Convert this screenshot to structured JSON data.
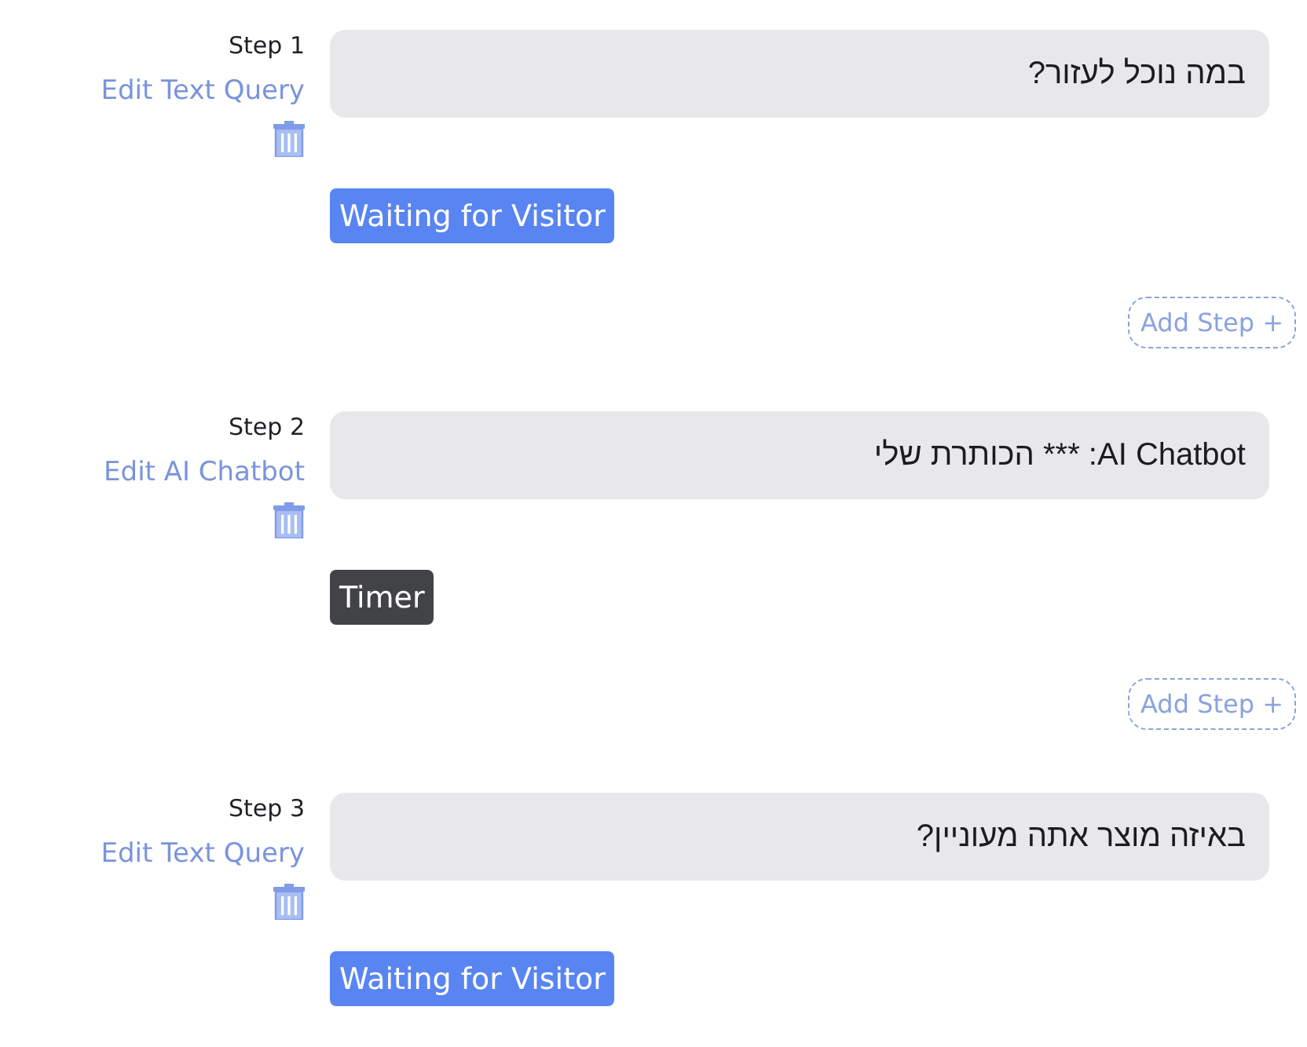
{
  "steps": [
    {
      "label": "Step 1",
      "edit_link": "Edit Text Query",
      "message": "במה נוכל לעזור?",
      "status": {
        "kind": "waiting",
        "label": "Waiting for Visitor"
      },
      "add_step": "Add Step +"
    },
    {
      "label": "Step 2",
      "edit_link": "Edit AI Chatbot",
      "message": "AI Chatbot: *** הכותרת שלי",
      "status": {
        "kind": "timer",
        "label": "Timer"
      },
      "add_step": "Add Step +"
    },
    {
      "label": "Step 3",
      "edit_link": "Edit Text Query",
      "message": "באיזה מוצר אתה מעוניין?",
      "status": {
        "kind": "waiting",
        "label": "Waiting for Visitor"
      }
    }
  ]
}
